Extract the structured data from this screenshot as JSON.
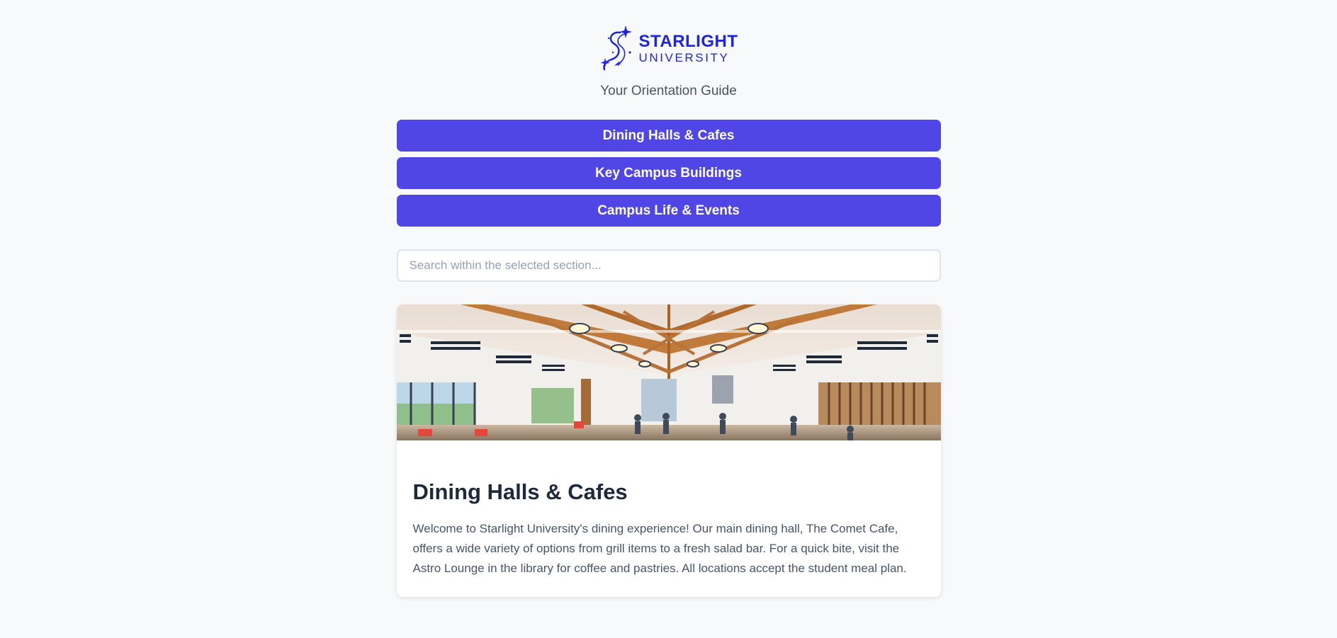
{
  "brand": {
    "name_line1": "STARLIGHT",
    "name_line2": "UNIVERSITY",
    "tagline": "Your Orientation Guide",
    "color": "#1f24e0"
  },
  "nav": {
    "accent_color": "#4f46e5",
    "items": [
      {
        "label": "Dining Halls & Cafes"
      },
      {
        "label": "Key Campus Buildings"
      },
      {
        "label": "Campus Life & Events"
      }
    ]
  },
  "search": {
    "placeholder": "Search within the selected section...",
    "value": ""
  },
  "section": {
    "title": "Dining Halls & Cafes",
    "description": "Welcome to Starlight University's dining experience! Our main dining hall, The Comet Cafe, offers a wide variety of options from grill items to a fresh salad bar. For a quick bite, visit the Astro Lounge in the library for coffee and pastries. All locations accept the student meal plan."
  }
}
